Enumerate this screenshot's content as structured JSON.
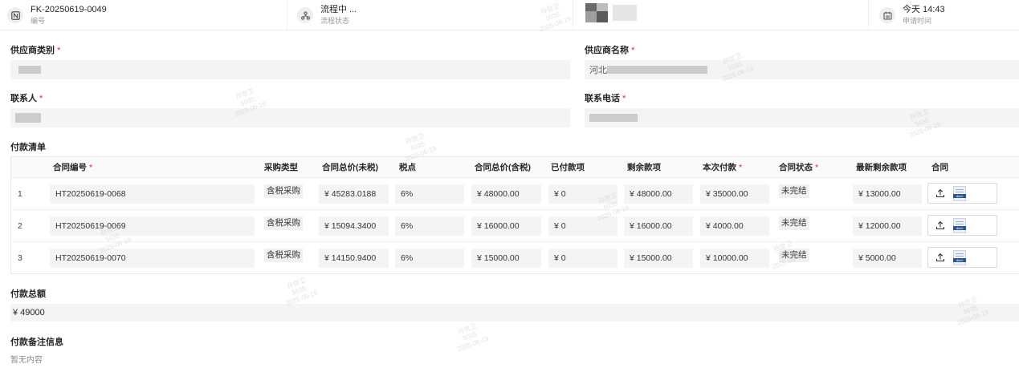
{
  "header": {
    "serial_value": "FK-20250619-0049",
    "serial_label": "编号",
    "flow_value": "流程中 ...",
    "flow_label": "流程状态",
    "time_value": "今天 14:43",
    "time_label": "申请时间"
  },
  "form": {
    "supplier_category_label": "供应商类别",
    "supplier_name_label": "供应商名称",
    "supplier_name_prefix": "河北",
    "contact_label": "联系人",
    "phone_label": "联系电话",
    "required_mark": "*"
  },
  "payment_list": {
    "section_title": "付款清单",
    "columns": [
      {
        "label": "合同编号",
        "required": true
      },
      {
        "label": "采购类型",
        "required": false
      },
      {
        "label": "合同总价(未税)",
        "required": false
      },
      {
        "label": "税点",
        "required": false
      },
      {
        "label": "合同总价(含税)",
        "required": false
      },
      {
        "label": "已付款项",
        "required": false
      },
      {
        "label": "剩余款项",
        "required": false
      },
      {
        "label": "本次付款",
        "required": true
      },
      {
        "label": "合同状态",
        "required": true
      },
      {
        "label": "最新剩余款项",
        "required": false
      },
      {
        "label": "合同",
        "required": false
      }
    ],
    "rows": [
      {
        "no": "1",
        "contract_no": "HT20250619-0068",
        "purchase_type": "含税采购",
        "price_ex_tax": "¥ 45283.0188",
        "tax_rate": "6%",
        "price_inc_tax": "¥ 48000.00",
        "paid": "¥ 0",
        "remaining": "¥ 48000.00",
        "this_payment": "¥ 35000.00",
        "status": "未完结",
        "new_remaining": "¥ 13000.00",
        "file_type": "docx"
      },
      {
        "no": "2",
        "contract_no": "HT20250619-0069",
        "purchase_type": "含税采购",
        "price_ex_tax": "¥ 15094.3400",
        "tax_rate": "6%",
        "price_inc_tax": "¥ 16000.00",
        "paid": "¥ 0",
        "remaining": "¥ 16000.00",
        "this_payment": "¥ 4000.00",
        "status": "未完结",
        "new_remaining": "¥ 12000.00",
        "file_type": "docx"
      },
      {
        "no": "3",
        "contract_no": "HT20250619-0070",
        "purchase_type": "含税采购",
        "price_ex_tax": "¥ 14150.9400",
        "tax_rate": "6%",
        "price_inc_tax": "¥ 15000.00",
        "paid": "¥ 0",
        "remaining": "¥ 15000.00",
        "this_payment": "¥ 10000.00",
        "status": "未完结",
        "new_remaining": "¥ 5000.00",
        "file_type": "docx"
      }
    ]
  },
  "total": {
    "label": "付款总额",
    "value": "¥ 49000"
  },
  "remark": {
    "label": "付款备注信息",
    "value": "暂无内容"
  },
  "watermark": {
    "name": "孙世卫",
    "id": "5035",
    "date": "2025-06-19"
  },
  "icons": {
    "serial": "serial-icon",
    "flow": "flow-icon",
    "calendar": "calendar-icon",
    "upload": "upload-icon",
    "file": "docx-file-icon"
  },
  "colors": {
    "required": "#f5222d",
    "field_bg": "#f4f4f4",
    "word_blue": "#2b579a"
  }
}
